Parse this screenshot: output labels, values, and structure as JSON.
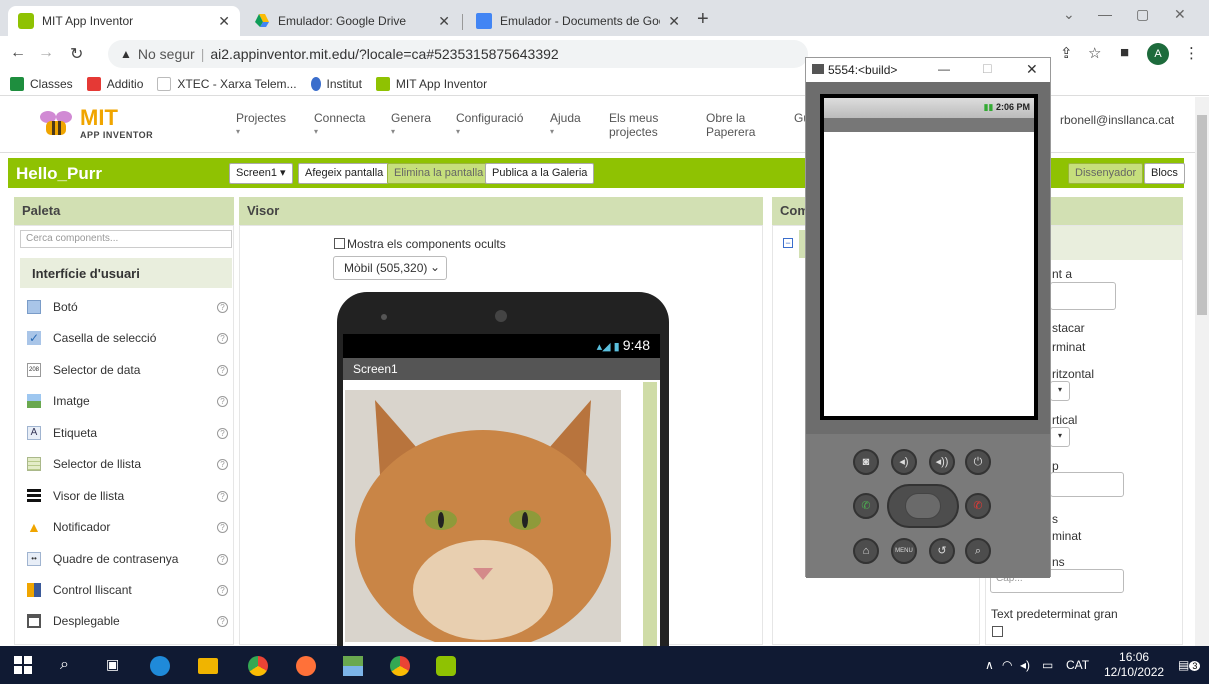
{
  "browser": {
    "tabs": [
      {
        "label": "MIT App Inventor",
        "active": true
      },
      {
        "label": "Emulador: Google Drive",
        "active": false
      },
      {
        "label": "Emulador - Documents de Goog",
        "active": false
      }
    ],
    "address": {
      "security_label": "No segur",
      "url": "ai2.appinventor.mit.edu/?locale=ca#5235315875643392"
    },
    "profile_initial": "A",
    "bookmarks": [
      {
        "label": "Classes",
        "color": "#1e8e3e"
      },
      {
        "label": "Additio",
        "color": "#e53935"
      },
      {
        "label": "XTEC - Xarxa Telem...",
        "color": "#555555"
      },
      {
        "label": "Institut",
        "color": "#3b6ecc"
      },
      {
        "label": "MIT App Inventor",
        "color": "#8fc202"
      }
    ]
  },
  "app": {
    "logo_text": "MIT",
    "logo_subtext": "APP INVENTOR",
    "menus": [
      {
        "label": "Projectes",
        "caret": true
      },
      {
        "label": "Connecta",
        "caret": true
      },
      {
        "label": "Genera",
        "caret": true
      },
      {
        "label": "Configuració",
        "caret": true
      },
      {
        "label": "Ajuda",
        "caret": true
      },
      {
        "label": "Els meus projectes",
        "caret": false
      },
      {
        "label": "Obre la Paperera",
        "caret": false
      }
    ],
    "menu_cut": "Gu",
    "user_email": "rbonell@insllanca.cat",
    "project_name": "Hello_Purr",
    "project_buttons": {
      "screen": "Screen1 ▾",
      "add_screen": "Afegeix pantalla",
      "remove_screen": "Elimina la pantalla",
      "publish": "Publica a la Galeria",
      "designer": "Dissenyador",
      "blocks": "Blocs"
    },
    "palette": {
      "title": "Paleta",
      "search_placeholder": "Cerca components...",
      "category": "Interfície d'usuari",
      "items": [
        {
          "label": "Botó",
          "icon": "button-icon"
        },
        {
          "label": "Casella de selecció",
          "icon": "checkbox-icon"
        },
        {
          "label": "Selector de data",
          "icon": "date-picker-icon"
        },
        {
          "label": "Imatge",
          "icon": "image-icon"
        },
        {
          "label": "Etiqueta",
          "icon": "label-icon"
        },
        {
          "label": "Selector de llista",
          "icon": "list-picker-icon"
        },
        {
          "label": "Visor de llista",
          "icon": "list-view-icon"
        },
        {
          "label": "Notificador",
          "icon": "notifier-icon"
        },
        {
          "label": "Quadre de contrasenya",
          "icon": "password-icon"
        },
        {
          "label": "Control lliscant",
          "icon": "slider-icon"
        },
        {
          "label": "Desplegable",
          "icon": "spinner-icon"
        }
      ]
    },
    "viewer": {
      "title": "Visor",
      "show_hidden_label": "Mostra els components ocults",
      "device_select": "Mòbil (505,320)",
      "phone_time": "9:48",
      "screen_title": "Screen1"
    },
    "components": {
      "title": "Com"
    },
    "properties": {
      "lines": [
        "nt a",
        "stacar",
        "rminat",
        "ritzontal",
        "rtical",
        "p",
        "s",
        "minat",
        "ns"
      ],
      "cap_placeholder": "Cap...",
      "large_text_label": "Text predeterminat gran"
    }
  },
  "emulator": {
    "window_title": "5554:<build>",
    "status_time": "2:06 PM",
    "menu_label": "MENU"
  },
  "taskbar": {
    "language": "CAT",
    "time": "16:06",
    "date": "12/10/2022",
    "notifications": "3"
  }
}
